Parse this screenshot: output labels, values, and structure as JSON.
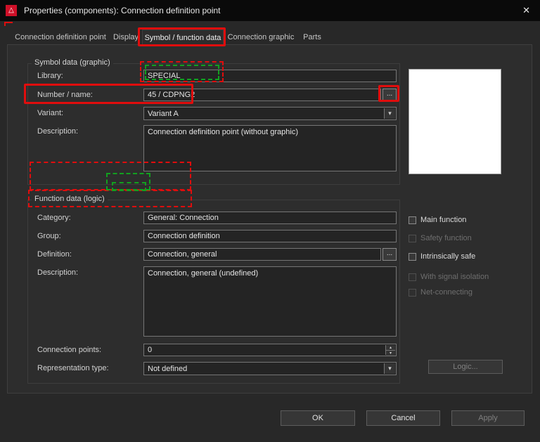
{
  "window": {
    "title": "Properties (components): Connection definition point"
  },
  "icons": {
    "logo": "△",
    "close": "✕",
    "dropdown": "▾",
    "spinner_up": "▴",
    "spinner_down": "▾",
    "browse": "..."
  },
  "tabs": [
    {
      "label": "Connection definition point",
      "selected": false
    },
    {
      "label": "Display",
      "selected": false
    },
    {
      "label": "Symbol / function data",
      "selected": true
    },
    {
      "label": "Connection graphic",
      "selected": false
    },
    {
      "label": "Parts",
      "selected": false
    }
  ],
  "symbol_group": {
    "title": "Symbol data (graphic)",
    "library_label": "Library:",
    "library_value": "SPECIAL",
    "number_label": "Number / name:",
    "number_value": "45 / CDPNG2",
    "variant_label": "Variant:",
    "variant_value": "Variant A",
    "description_label": "Description:",
    "description_value": "Connection definition point (without graphic)"
  },
  "function_group": {
    "title": "Function data (logic)",
    "category_label": "Category:",
    "category_value": "General: Connection",
    "group_label": "Group:",
    "group_value": "Connection definition",
    "definition_label": "Definition:",
    "definition_value": "Connection, general",
    "description_label": "Description:",
    "description_value": "Connection, general (undefined)",
    "connection_points_label": "Connection points:",
    "connection_points_value": "0",
    "representation_label": "Representation type:",
    "representation_value": "Not defined",
    "checkboxes": [
      {
        "label": "Main function",
        "enabled": true,
        "checked": false
      },
      {
        "label": "Safety function",
        "enabled": false,
        "checked": false
      },
      {
        "label": "Intrinsically safe",
        "enabled": true,
        "checked": false
      },
      {
        "label": "With signal isolation",
        "enabled": false,
        "checked": false
      },
      {
        "label": "Net-connecting",
        "enabled": false,
        "checked": false
      }
    ],
    "logic_label": "Logic..."
  },
  "footer": {
    "ok": "OK",
    "cancel": "Cancel",
    "apply": "Apply"
  },
  "colors": {
    "annotation_red": "#e00d0d",
    "annotation_green": "#12a01f",
    "logo_red": "#cf1028"
  }
}
